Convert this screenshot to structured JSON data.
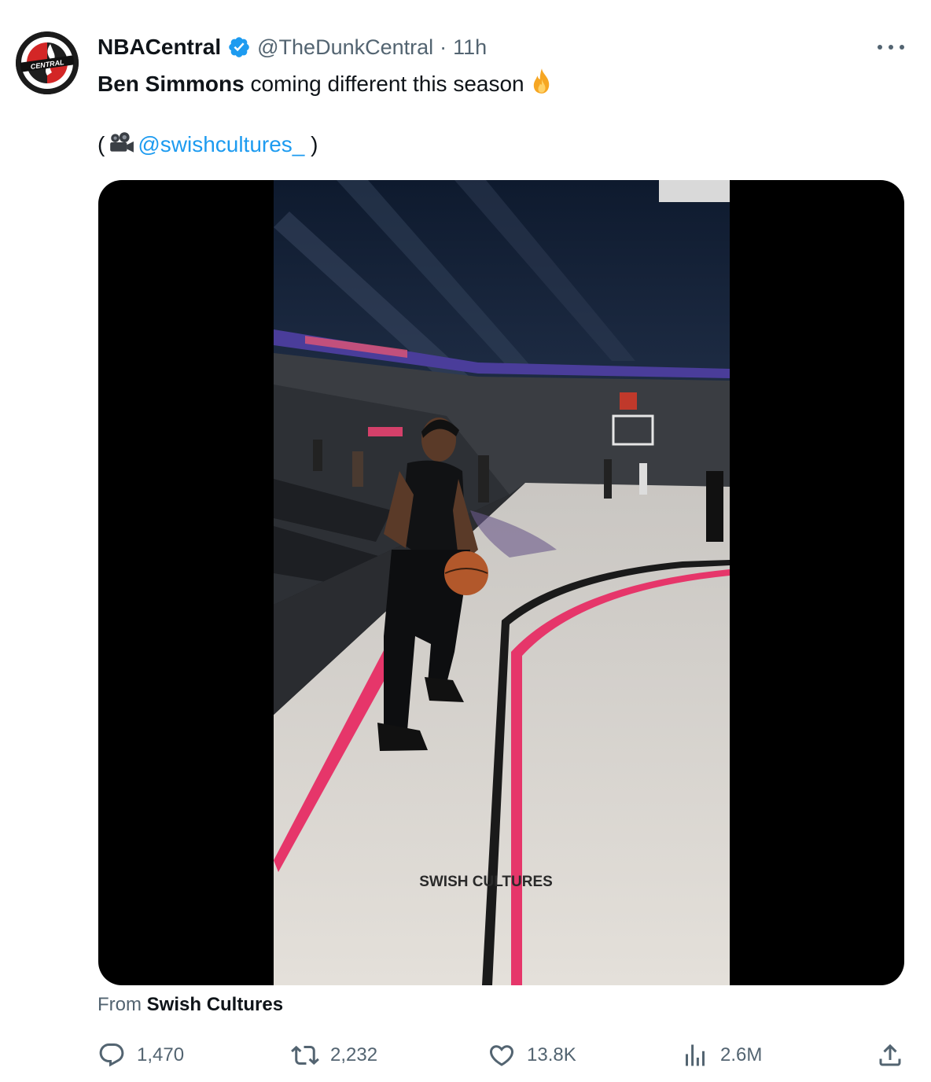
{
  "tweet": {
    "author": {
      "display_name": "NBACentral",
      "handle": "@TheDunkCentral",
      "separator": "·",
      "time": "11h",
      "avatar_text": "CENTRAL"
    },
    "text": {
      "bold": "Ben Simmons",
      "rest": " coming different this season",
      "emoji": "fire-icon"
    },
    "credit": {
      "open": "(",
      "mention": "@swishcultures_",
      "close": " )"
    },
    "media": {
      "watermark": "SWISH CULTURES"
    },
    "source": {
      "prefix": "From ",
      "name": "Swish Cultures"
    },
    "stats": {
      "replies": "1,470",
      "retweets": "2,232",
      "likes": "13.8K",
      "views": "2.6M"
    }
  },
  "colors": {
    "link": "#1d9bf0",
    "muted": "#536471",
    "text": "#0f1419"
  }
}
